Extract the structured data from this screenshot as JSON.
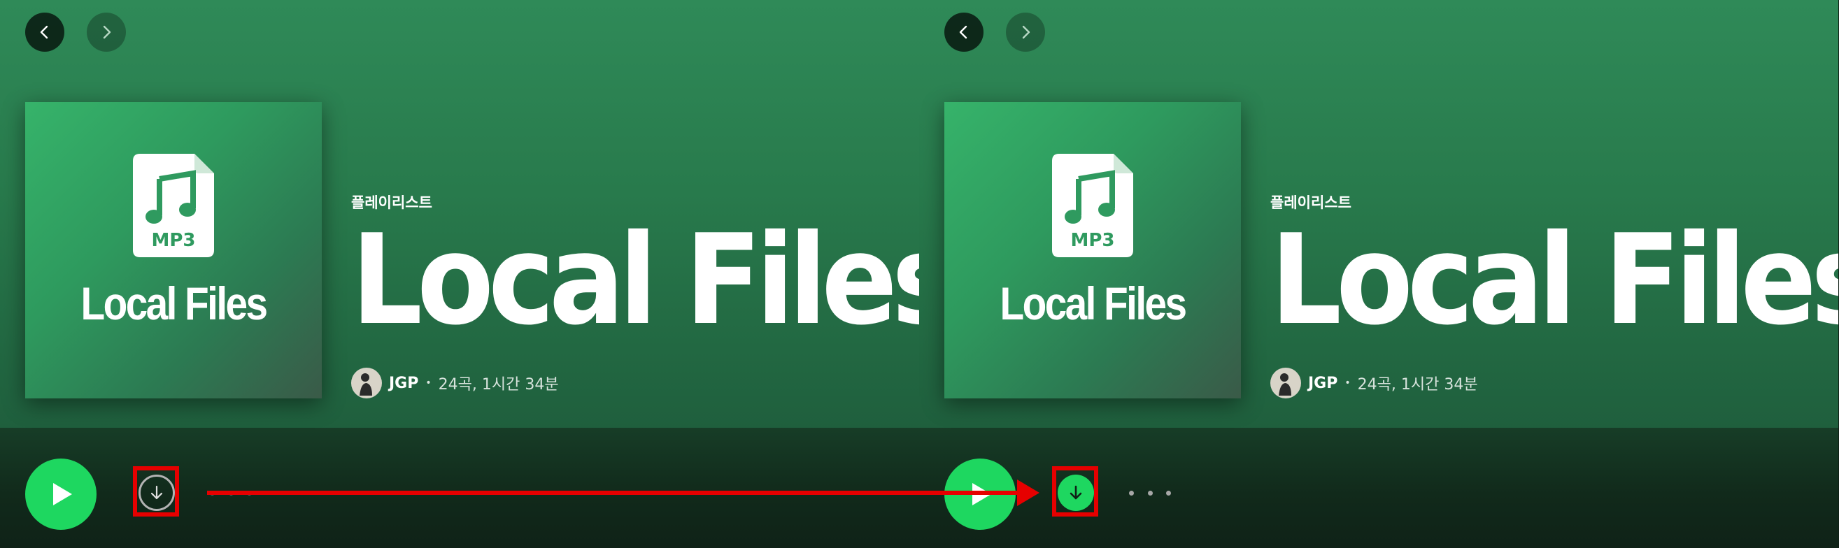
{
  "colors": {
    "accent_green": "#1ed760",
    "hero_green": "#2f8a58",
    "annotation_red": "#e60000"
  },
  "panels": [
    {
      "nav": {
        "back_icon": "chevron-left-icon",
        "forward_icon": "chevron-right-icon"
      },
      "cover": {
        "badge": "MP3",
        "title": "Local Files",
        "icon": "music-file-icon"
      },
      "type_label": "플레이리스트",
      "title": "Local Files",
      "owner": "JGP",
      "separator": "•",
      "stats": "24곡, 1시간 34분",
      "download_state": "not-downloaded"
    },
    {
      "nav": {
        "back_icon": "chevron-left-icon",
        "forward_icon": "chevron-right-icon"
      },
      "cover": {
        "badge": "MP3",
        "title": "Local Files",
        "icon": "music-file-icon"
      },
      "type_label": "플레이리스트",
      "title": "Local Files",
      "owner": "JGP",
      "separator": "•",
      "stats": "24곡, 1시간 34분",
      "download_state": "downloaded"
    }
  ]
}
